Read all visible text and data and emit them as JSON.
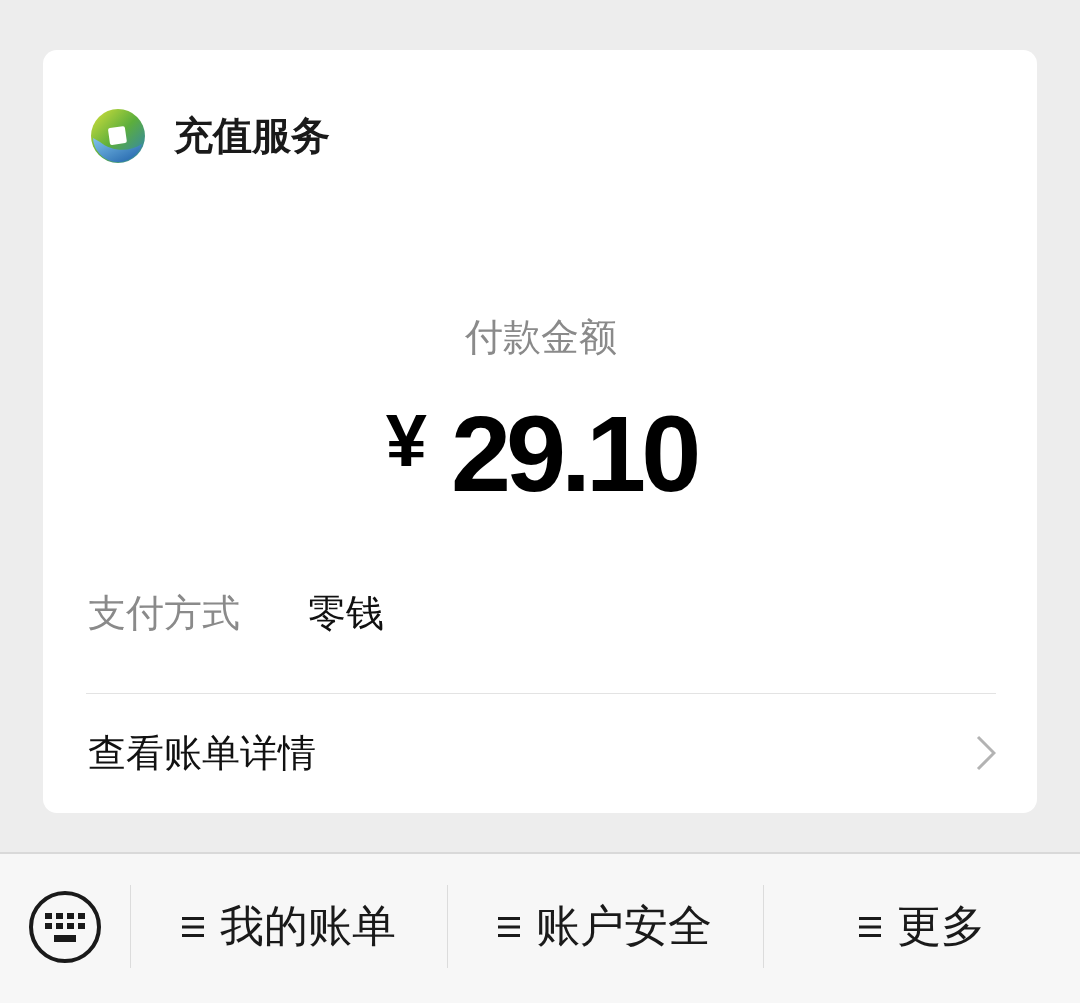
{
  "merchant": {
    "name": "充值服务"
  },
  "payment": {
    "amount_label": "付款金额",
    "currency": "¥",
    "amount": "29.10"
  },
  "details": [
    {
      "label": "支付方式",
      "value": "零钱"
    }
  ],
  "bill_link": {
    "label": "查看账单详情"
  },
  "bottom_menu": {
    "items": [
      {
        "label": "我的账单"
      },
      {
        "label": "账户安全"
      },
      {
        "label": "更多"
      }
    ]
  }
}
